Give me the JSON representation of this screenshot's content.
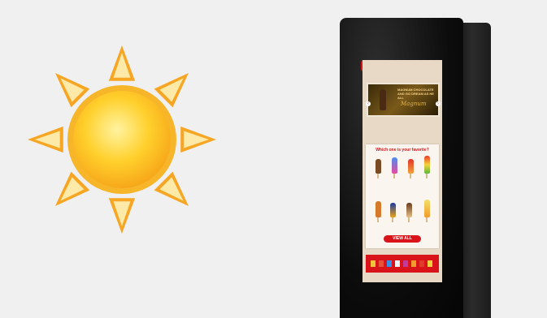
{
  "scene": {
    "sun": {
      "colors": {
        "core": "#ffc21a",
        "rim": "#f6a623",
        "ray": "#f8c74a"
      }
    },
    "kiosk": {
      "logo_icon": "heart-brand-logo",
      "banner": {
        "headline": "MAGNUM CHOCOLATE AND GO DREAM AS HE ALL",
        "script": "Magnum"
      },
      "question": "Which one is your favorite?",
      "view_all_label": "VIEW ALL",
      "colors": {
        "brand_red": "#d8141a",
        "frame": "#e8d9c6"
      }
    }
  }
}
